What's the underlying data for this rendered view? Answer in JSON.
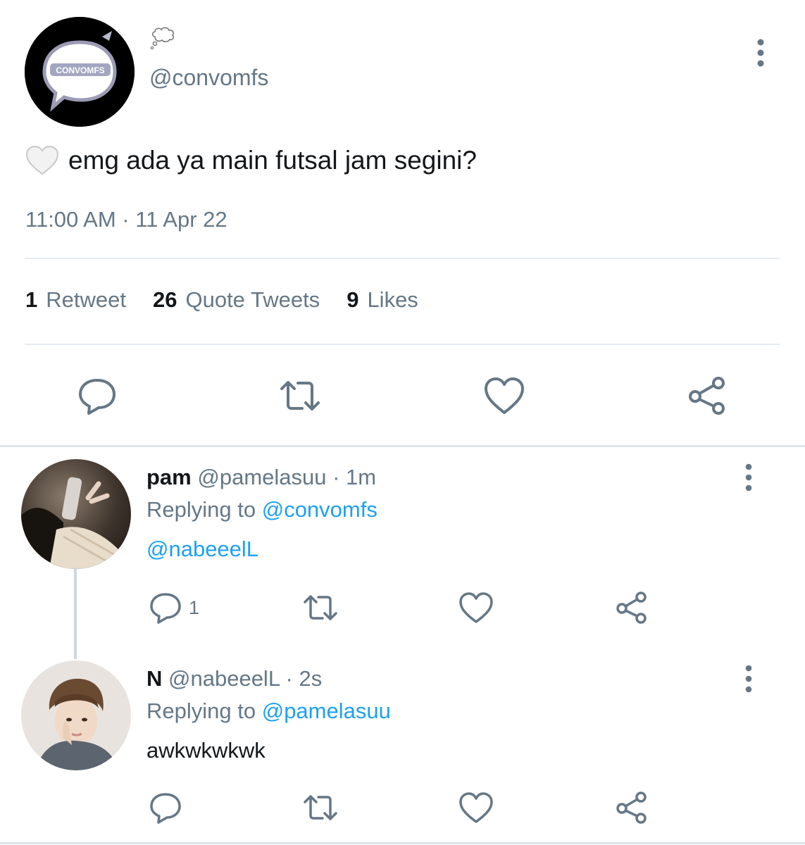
{
  "main_tweet": {
    "avatar_text": "CONVOMFS",
    "handle": "@convomfs",
    "text": "emg ada ya main futsal jam segini?",
    "timestamp": "11:00 AM · 11 Apr 22",
    "stats": {
      "retweets_count": "1",
      "retweets_label": "Retweet",
      "quotes_count": "26",
      "quotes_label": "Quote Tweets",
      "likes_count": "9",
      "likes_label": "Likes"
    }
  },
  "replies": [
    {
      "name": "pam",
      "handle_time": "@pamelasuu · 1m",
      "replying_prefix": "Replying to",
      "replying_to": "@convomfs",
      "text": "@nabeeelL",
      "reply_count": "1"
    },
    {
      "name": "N",
      "handle_time": "@nabeeelL · 2s",
      "replying_prefix": "Replying to",
      "replying_to": "@pamelasuu",
      "text": "awkwkwkwk",
      "reply_count": ""
    }
  ],
  "icons": {
    "reply": "reply-icon",
    "retweet": "retweet-icon",
    "like": "heart-icon",
    "share": "share-icon",
    "more": "more-vertical-icon"
  },
  "colors": {
    "accent": "#1da1f2",
    "secondary_text": "#657786",
    "icon": "#657786",
    "divider": "#e6ecf0"
  }
}
